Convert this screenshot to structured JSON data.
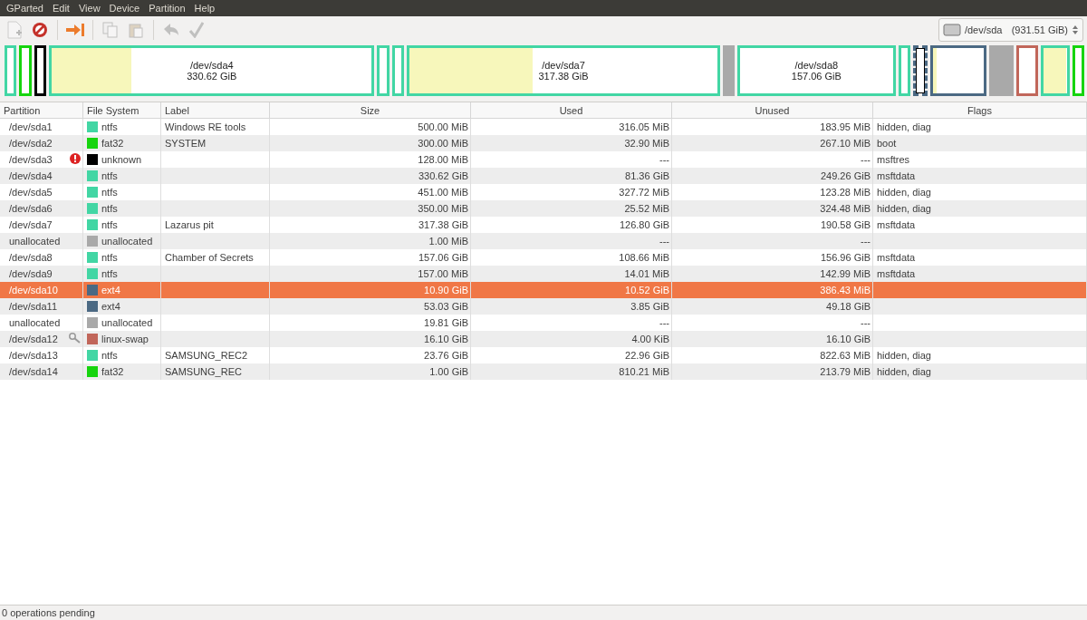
{
  "menu": [
    "GParted",
    "Edit",
    "View",
    "Device",
    "Partition",
    "Help"
  ],
  "toolbar": [
    {
      "kind": "new",
      "disabled": true
    },
    {
      "kind": "delete",
      "disabled": false
    },
    {
      "kind": "sep"
    },
    {
      "kind": "resize",
      "disabled": false
    },
    {
      "kind": "sep"
    },
    {
      "kind": "copy",
      "disabled": true
    },
    {
      "kind": "paste",
      "disabled": true
    },
    {
      "kind": "sep"
    },
    {
      "kind": "undo",
      "disabled": true
    },
    {
      "kind": "apply",
      "disabled": true
    }
  ],
  "device": {
    "name": "/dev/sda",
    "size": "(931.51 GiB)"
  },
  "disk_map": [
    {
      "kind": "partition",
      "color": "#42d6a4",
      "selected": false
    },
    {
      "kind": "partition",
      "color": "#16d40e",
      "selected": false
    },
    {
      "kind": "partition",
      "color": "#000000",
      "selected": false
    },
    {
      "kind": "partition",
      "color": "#42d6a4",
      "level": 0.25,
      "selected": false,
      "name": "/dev/sda4",
      "size": "330.62 GiB"
    },
    {
      "kind": "partition",
      "color": "#42d6a4",
      "selected": false
    },
    {
      "kind": "partition",
      "color": "#42d6a4",
      "selected": false
    },
    {
      "kind": "partition",
      "color": "#42d6a4",
      "level": 0.4,
      "selected": false,
      "name": "/dev/sda7",
      "size": "317.38 GiB"
    },
    {
      "kind": "unallocated",
      "color": "#a9a9a9"
    },
    {
      "kind": "partition",
      "color": "#42d6a4",
      "level": 0,
      "selected": false,
      "name": "/dev/sda8",
      "size": "157.06 GiB"
    },
    {
      "kind": "partition",
      "color": "#42d6a4",
      "selected": false
    },
    {
      "kind": "partition",
      "color": "#4b6983",
      "selected": true
    },
    {
      "kind": "partition",
      "color": "#4b6983",
      "level": 0.07,
      "selected": false
    },
    {
      "kind": "unallocated",
      "color": "#a9a9a9"
    },
    {
      "kind": "partition",
      "color": "#c1665a",
      "selected": false
    },
    {
      "kind": "partition",
      "color": "#42d6a4",
      "level": 0.97,
      "selected": false
    },
    {
      "kind": "partition",
      "color": "#16d40e",
      "selected": false
    }
  ],
  "table": {
    "columns": [
      "Partition",
      "File System",
      "Label",
      "Size",
      "Used",
      "Unused",
      "Flags"
    ],
    "rows": [
      {
        "partition": "/dev/sda1",
        "error": false,
        "active": false,
        "fs": "ntfs",
        "color": "#42d6a4",
        "label": "Windows RE tools",
        "size": "500.00 MiB",
        "used": "316.05 MiB",
        "unused": "183.95 MiB",
        "flags": "hidden, diag",
        "selected": false
      },
      {
        "partition": "/dev/sda2",
        "error": false,
        "active": false,
        "fs": "fat32",
        "color": "#16d40e",
        "label": "SYSTEM",
        "size": "300.00 MiB",
        "used": "32.90 MiB",
        "unused": "267.10 MiB",
        "flags": "boot",
        "selected": false
      },
      {
        "partition": "/dev/sda3",
        "error": true,
        "active": false,
        "fs": "unknown",
        "color": "#000000",
        "size": "128.00 MiB",
        "used": "---",
        "unused": "---",
        "flags": "msftres",
        "selected": false
      },
      {
        "partition": "/dev/sda4",
        "error": false,
        "active": false,
        "fs": "ntfs",
        "color": "#42d6a4",
        "size": "330.62 GiB",
        "used": "81.36 GiB",
        "unused": "249.26 GiB",
        "flags": "msftdata",
        "selected": false
      },
      {
        "partition": "/dev/sda5",
        "error": false,
        "active": false,
        "fs": "ntfs",
        "color": "#42d6a4",
        "size": "451.00 MiB",
        "used": "327.72 MiB",
        "unused": "123.28 MiB",
        "flags": "hidden, diag",
        "selected": false
      },
      {
        "partition": "/dev/sda6",
        "error": false,
        "active": false,
        "fs": "ntfs",
        "color": "#42d6a4",
        "size": "350.00 MiB",
        "used": "25.52 MiB",
        "unused": "324.48 MiB",
        "flags": "hidden, diag",
        "selected": false
      },
      {
        "partition": "/dev/sda7",
        "error": false,
        "active": false,
        "fs": "ntfs",
        "color": "#42d6a4",
        "label": "Lazarus pit",
        "size": "317.38 GiB",
        "used": "126.80 GiB",
        "unused": "190.58 GiB",
        "flags": "msftdata",
        "selected": false
      },
      {
        "partition": "unallocated",
        "error": false,
        "active": false,
        "fs": "unallocated",
        "color": "#a9a9a9",
        "size": "1.00 MiB",
        "used": "---",
        "unused": "---",
        "selected": false
      },
      {
        "partition": "/dev/sda8",
        "error": false,
        "active": false,
        "fs": "ntfs",
        "color": "#42d6a4",
        "label": "Chamber of Secrets",
        "size": "157.06 GiB",
        "used": "108.66 MiB",
        "unused": "156.96 GiB",
        "flags": "msftdata",
        "selected": false
      },
      {
        "partition": "/dev/sda9",
        "error": false,
        "active": false,
        "fs": "ntfs",
        "color": "#42d6a4",
        "size": "157.00 MiB",
        "used": "14.01 MiB",
        "unused": "142.99 MiB",
        "flags": "msftdata",
        "selected": false
      },
      {
        "partition": "/dev/sda10",
        "error": false,
        "active": false,
        "fs": "ext4",
        "color": "#4b6983",
        "size": "10.90 GiB",
        "used": "10.52 GiB",
        "unused": "386.43 MiB",
        "selected": true
      },
      {
        "partition": "/dev/sda11",
        "error": false,
        "active": false,
        "fs": "ext4",
        "color": "#4b6983",
        "size": "53.03 GiB",
        "used": "3.85 GiB",
        "unused": "49.18 GiB",
        "selected": false
      },
      {
        "partition": "unallocated",
        "error": false,
        "active": false,
        "fs": "unallocated",
        "color": "#a9a9a9",
        "size": "19.81 GiB",
        "used": "---",
        "unused": "---",
        "selected": false
      },
      {
        "partition": "/dev/sda12",
        "error": false,
        "active": true,
        "fs": "linux-swap",
        "color": "#c1665a",
        "size": "16.10 GiB",
        "used": "4.00 KiB",
        "unused": "16.10 GiB",
        "selected": false
      },
      {
        "partition": "/dev/sda13",
        "error": false,
        "active": false,
        "fs": "ntfs",
        "color": "#42d6a4",
        "label": "SAMSUNG_REC2",
        "size": "23.76 GiB",
        "used": "22.96 GiB",
        "unused": "822.63 MiB",
        "flags": "hidden, diag",
        "selected": false
      },
      {
        "partition": "/dev/sda14",
        "error": false,
        "active": false,
        "fs": "fat32",
        "color": "#16d40e",
        "label": "SAMSUNG_REC",
        "size": "1.00 GiB",
        "used": "810.21 MiB",
        "unused": "213.79 MiB",
        "flags": "hidden, diag",
        "selected": false
      }
    ]
  },
  "status_bar": "0 operations pending"
}
